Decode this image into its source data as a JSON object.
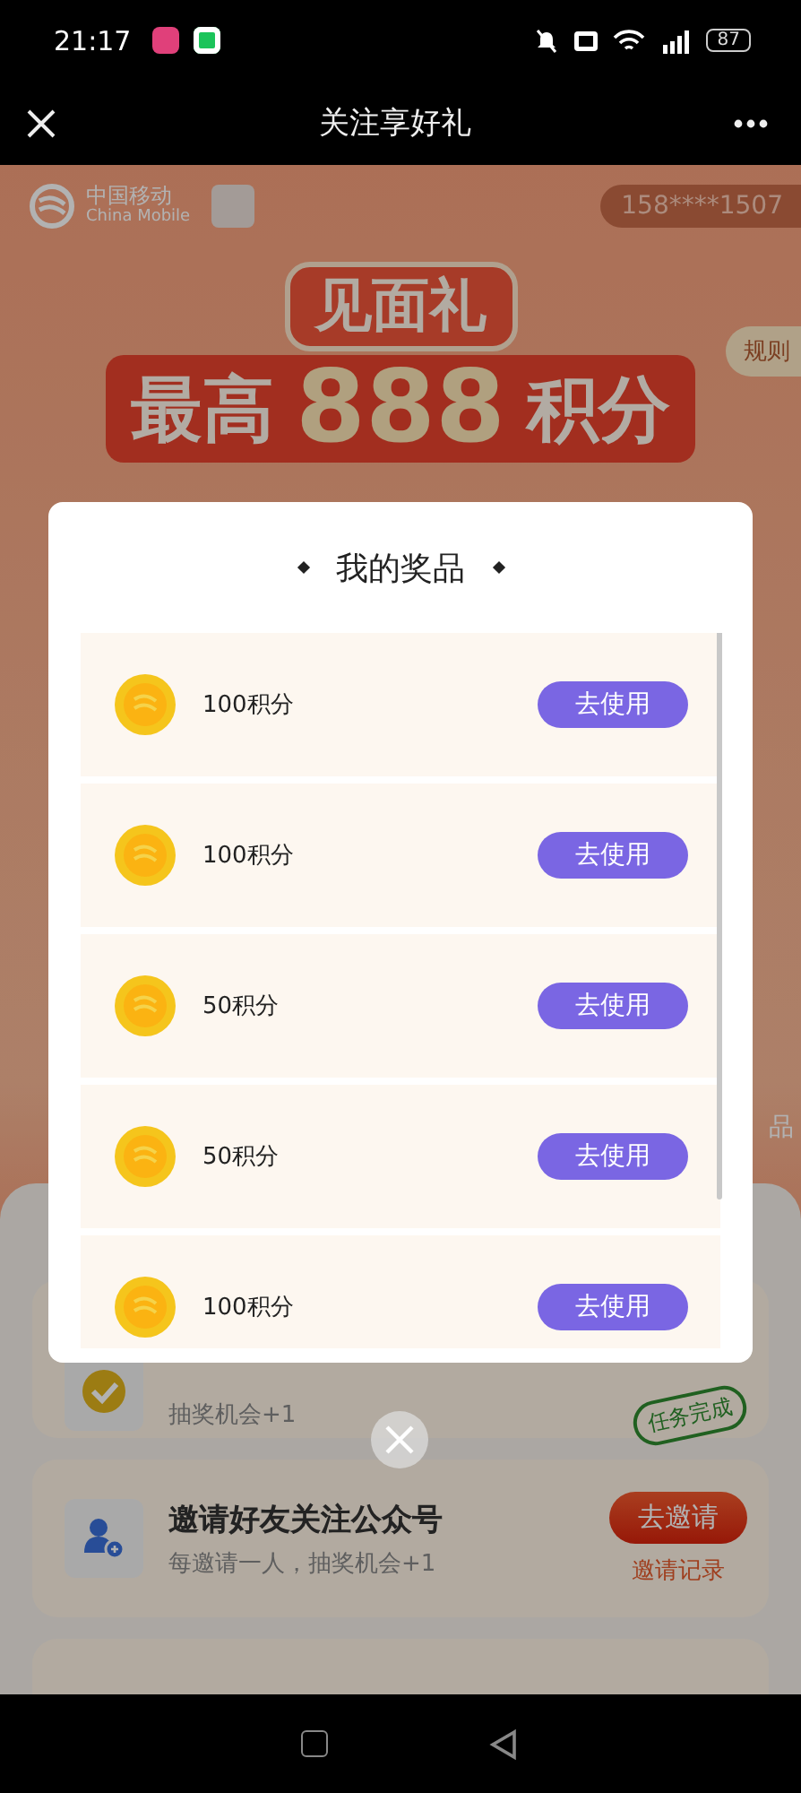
{
  "status_bar": {
    "time": "21:17",
    "battery": "87"
  },
  "nav": {
    "title": "关注享好礼"
  },
  "header": {
    "brand": "中国移动",
    "brand_en": "China Mobile",
    "phone": "158****1507",
    "rules": "规则"
  },
  "banner": {
    "line1": "见面礼",
    "prefix": "最高",
    "number": "888",
    "suffix": "积分"
  },
  "side_text": "品",
  "modal": {
    "title": "我的奖品",
    "prizes": [
      {
        "label": "100积分",
        "button": "去使用"
      },
      {
        "label": "100积分",
        "button": "去使用"
      },
      {
        "label": "50积分",
        "button": "去使用"
      },
      {
        "label": "50积分",
        "button": "去使用"
      },
      {
        "label": "100积分",
        "button": "去使用"
      }
    ]
  },
  "tasks": [
    {
      "kind": "done",
      "subtitle": "抽奖机会+1",
      "stamp": "任务完成"
    },
    {
      "kind": "invite",
      "title": "邀请好友关注公众号",
      "subtitle": "每邀请一人，抽奖机会+1",
      "button": "去邀请",
      "link": "邀请记录"
    },
    {
      "kind": "empty"
    }
  ]
}
